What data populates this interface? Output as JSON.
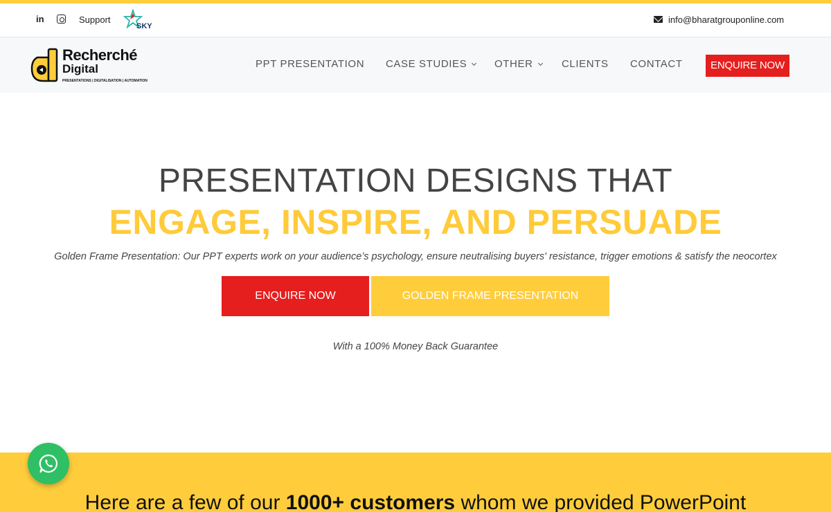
{
  "topbar": {
    "linkedin_icon": "linkedin-icon",
    "linkedin_text": "in",
    "instagram_icon": "instagram-icon",
    "support_label": "Support",
    "partner_logo_text": "SKY",
    "email_icon": "envelope-icon",
    "email": "info@bharatgrouponline.com"
  },
  "brand": {
    "name": "Recherché",
    "sub": "Digital",
    "tagline": "PRESENTATIONS | DIGITALISATION | AUTOMATION"
  },
  "nav": {
    "items": [
      {
        "label": "PPT PRESENTATION",
        "has_dropdown": false
      },
      {
        "label": "CASE STUDIES",
        "has_dropdown": true
      },
      {
        "label": "OTHER",
        "has_dropdown": true
      },
      {
        "label": "CLIENTS",
        "has_dropdown": false
      },
      {
        "label": "CONTACT",
        "has_dropdown": false
      }
    ],
    "cta": "ENQUIRE NOW"
  },
  "hero": {
    "title_line1": "PRESENTATION DESIGNS THAT",
    "title_line2": "ENGAGE, INSPIRE, AND PERSUADE",
    "subtitle": "Golden Frame Presentation: Our PPT experts work on your audience’s psychology, ensure neutralising buyers' resistance, trigger emotions & satisfy the neocortex",
    "primary_button": "ENQUIRE NOW",
    "secondary_button": "GOLDEN FRAME PRESENTATION",
    "guarantee": "With a 100% Money Back Guarantee"
  },
  "customers_band": {
    "text_before": "Here are a few of our ",
    "text_bold": "1000+ customers",
    "text_after": " whom we provided PowerPoint"
  },
  "whatsapp": {
    "icon": "whatsapp-icon"
  },
  "colors": {
    "accent_yellow": "#ffcd3c",
    "accent_red": "#e51e1e",
    "whatsapp_green": "#2fbf64"
  }
}
